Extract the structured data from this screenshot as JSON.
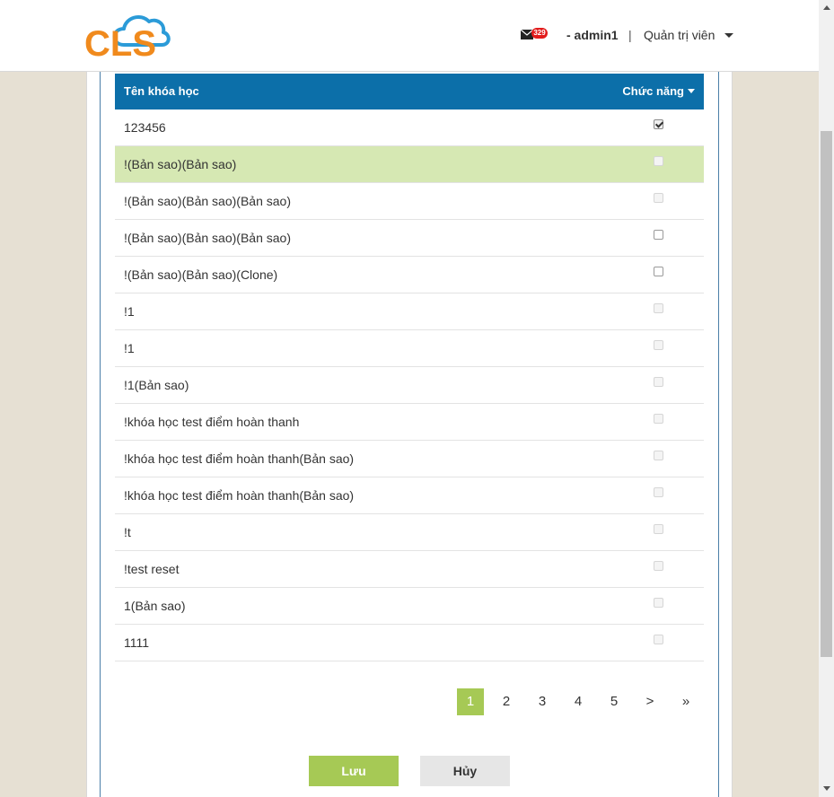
{
  "header": {
    "logo_text": "CLS",
    "mail_count": "329",
    "username": "- admin1",
    "separator": "|",
    "role": "Quản trị viên"
  },
  "table": {
    "col_name": "Tên khóa học",
    "col_function": "Chức năng",
    "rows": [
      {
        "name": "123456",
        "checkbox": "checked",
        "highlighted": false
      },
      {
        "name": "!(Bản sao)(Bản sao)",
        "checkbox": "disabled",
        "highlighted": true
      },
      {
        "name": "!(Bản sao)(Bản sao)(Bản sao)",
        "checkbox": "disabled",
        "highlighted": false
      },
      {
        "name": "!(Bản sao)(Bản sao)(Bản sao)",
        "checkbox": "unchecked",
        "highlighted": false
      },
      {
        "name": "!(Bản sao)(Bản sao)(Clone)",
        "checkbox": "unchecked",
        "highlighted": false
      },
      {
        "name": "!1",
        "checkbox": "disabled",
        "highlighted": false
      },
      {
        "name": "!1",
        "checkbox": "disabled",
        "highlighted": false
      },
      {
        "name": "!1(Bản sao)",
        "checkbox": "disabled",
        "highlighted": false
      },
      {
        "name": "!khóa học test điểm hoàn thanh",
        "checkbox": "disabled",
        "highlighted": false
      },
      {
        "name": "!khóa học test điểm hoàn thanh(Bản sao)",
        "checkbox": "disabled",
        "highlighted": false
      },
      {
        "name": "!khóa học test điểm hoàn thanh(Bản sao)",
        "checkbox": "disabled",
        "highlighted": false
      },
      {
        "name": "!t",
        "checkbox": "disabled",
        "highlighted": false
      },
      {
        "name": "!test reset",
        "checkbox": "disabled",
        "highlighted": false
      },
      {
        "name": "1(Bản sao)",
        "checkbox": "disabled",
        "highlighted": false
      },
      {
        "name": "1111",
        "checkbox": "disabled",
        "highlighted": false
      }
    ]
  },
  "pagination": {
    "pages": [
      "1",
      "2",
      "3",
      "4",
      "5",
      ">",
      "»"
    ],
    "active": "1"
  },
  "buttons": {
    "save": "Lưu",
    "cancel": "Hủy"
  },
  "colors": {
    "header_blue": "#0c6fa9",
    "accent_green": "#a6c955",
    "highlight_row": "#d6e8b3",
    "logo_orange": "#f08a1d",
    "logo_blue": "#2b9bd8",
    "badge_red": "#e21b1b"
  }
}
